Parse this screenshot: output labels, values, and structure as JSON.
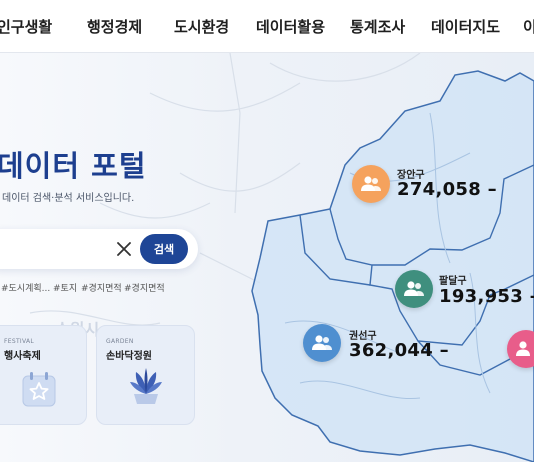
{
  "nav": {
    "items": [
      "인구생활",
      "행정경제",
      "도시환경",
      "데이터활용",
      "통계조사",
      "데이터지도",
      "이"
    ]
  },
  "hero": {
    "title": "데이터 포털",
    "subtitle": "데이터 검색·분석 서비스입니다.",
    "search": {
      "button_label": "검색",
      "clear_icon": "close-icon"
    },
    "tags": [
      "#도시계획...",
      "#토지",
      "#경지면적",
      "#경지면적"
    ],
    "cards": [
      {
        "eng": "FESTIVAL",
        "label": "행사축제",
        "icon": "calendar-star-icon"
      },
      {
        "eng": "GARDEN",
        "label": "손바닥정원",
        "icon": "plant-icon"
      }
    ]
  },
  "map": {
    "labels": [
      "수원시"
    ],
    "districts": [
      {
        "name": "장안구",
        "value": "274,058 –",
        "color": "#f5a25d"
      },
      {
        "name": "팔달구",
        "value": "193,953 –",
        "color": "#3f8f7e"
      },
      {
        "name": "권선구",
        "value": "362,044 –",
        "color": "#4f8fd0"
      },
      {
        "name": "",
        "value": "",
        "color": "#e85d8a"
      }
    ],
    "colors": {
      "region_fill": "#cfe3f6",
      "region_border": "#3f6fb0",
      "accent": "#1e4596"
    }
  }
}
